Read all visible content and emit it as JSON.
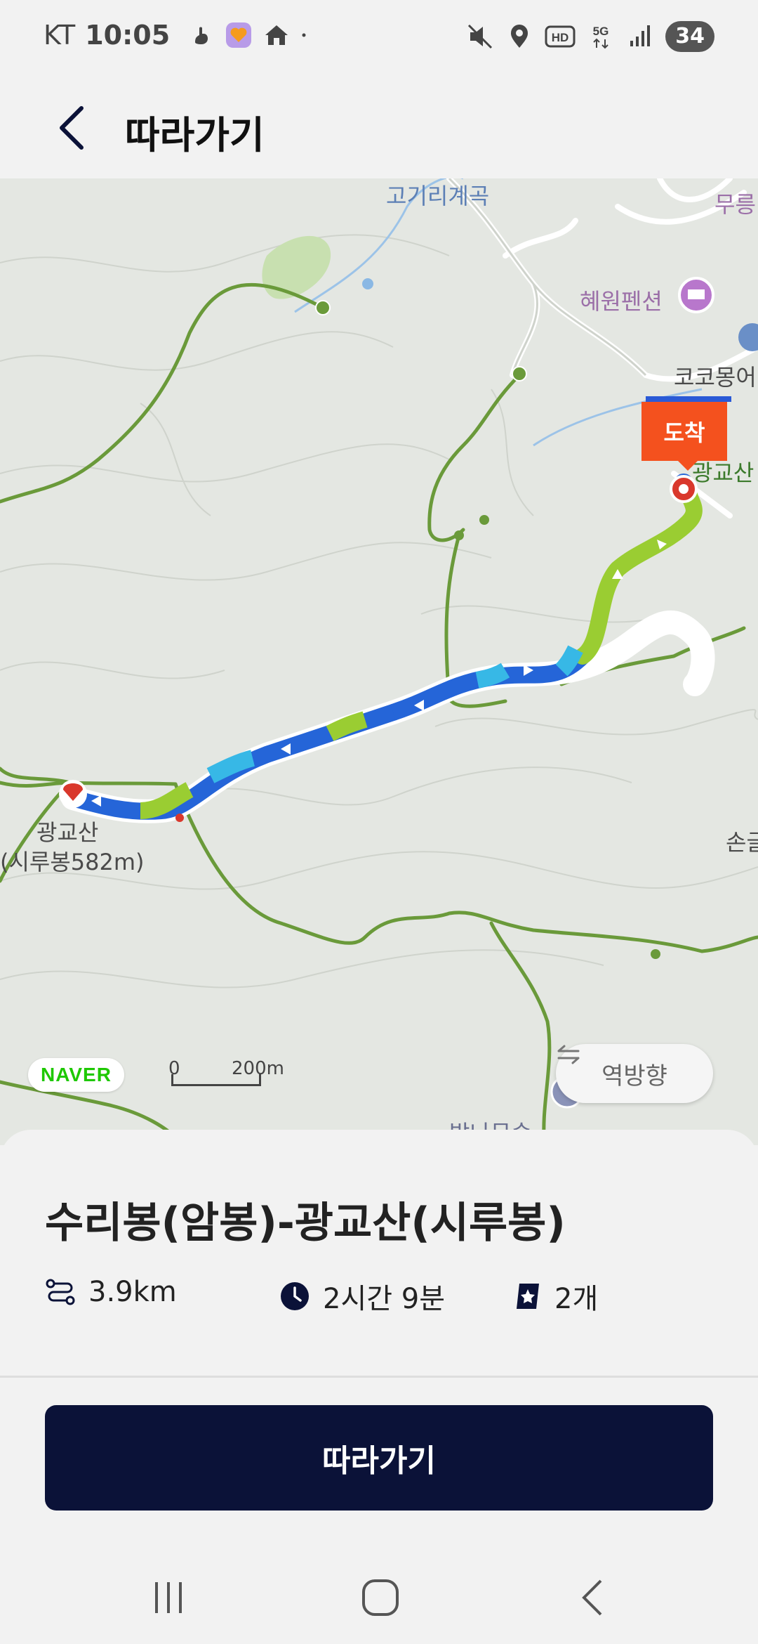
{
  "status": {
    "carrier": "KT",
    "time": "10:05",
    "battery": "34",
    "icons": [
      "hand-icon",
      "heart-app-icon",
      "home-app-icon",
      "dot-icon",
      "mute-icon",
      "location-icon",
      "hd-icon",
      "5g-icon",
      "signal-icon",
      "battery-icon"
    ]
  },
  "header": {
    "title": "따라가기"
  },
  "map": {
    "labels": {
      "valley": "고기리계곡",
      "pension": "혜원펜션",
      "partial_top_right": "무릉",
      "partial_cocomong": "코코몽어",
      "partial_gwanggyo_right": "광교산",
      "start_peak_name": "광교산",
      "start_peak_detail": "(시루봉582m)",
      "partial_right_edge": "손글",
      "partial_bottom": "밤나무숲"
    },
    "arrive_label": "도착",
    "naver_logo": "NAVER",
    "scale_zero": "0",
    "scale_value": "200m",
    "reverse_button": "역방향",
    "colors": {
      "trail": "#6a9a3a",
      "route_blue": "#2565d8",
      "route_light": "#9acd32",
      "route_cyan": "#37b8e6",
      "arrive": "#f4511e"
    }
  },
  "course": {
    "title": "수리봉(암봉)-광교산(시루봉)",
    "distance": "3.9km",
    "duration": "2시간 9분",
    "stamps": "2개"
  },
  "actions": {
    "follow": "따라가기"
  },
  "nav": {
    "icons": [
      "recent-apps-icon",
      "home-icon",
      "back-icon"
    ]
  }
}
